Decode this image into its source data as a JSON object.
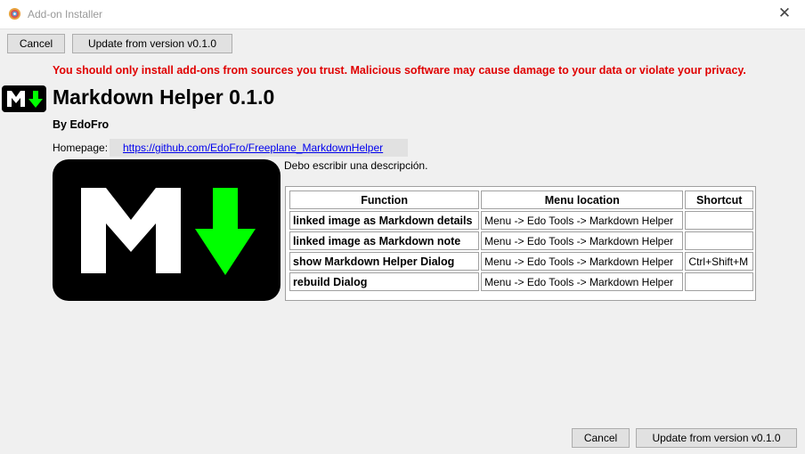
{
  "window": {
    "title": "Add-on Installer",
    "close_glyph": "✕"
  },
  "buttons": {
    "cancel": "Cancel",
    "update": "Update from version v0.1.0"
  },
  "warning": "You should only install add-ons from sources you trust. Malicious software may cause damage to your data or violate your privacy.",
  "addon": {
    "title": "Markdown Helper 0.1.0",
    "author": "By EdoFro",
    "homepage_label": "Homepage:",
    "homepage_url": "https://github.com/EdoFro/Freeplane_MarkdownHelper",
    "description": "Debo escribir una descripción.",
    "logo_colors": {
      "background": "#000000",
      "letter": "#ffffff",
      "arrow": "#00ff00"
    }
  },
  "table": {
    "headers": [
      "Function",
      "Menu location",
      "Shortcut"
    ],
    "rows": [
      {
        "function": "linked image as Markdown details",
        "menu": "Menu -> Edo Tools -> Markdown Helper",
        "shortcut": ""
      },
      {
        "function": "linked image as Markdown note",
        "menu": "Menu -> Edo Tools -> Markdown Helper",
        "shortcut": ""
      },
      {
        "function": "show Markdown Helper Dialog",
        "menu": "Menu -> Edo Tools -> Markdown Helper",
        "shortcut": "Ctrl+Shift+M"
      },
      {
        "function": "rebuild Dialog",
        "menu": "Menu -> Edo Tools -> Markdown Helper",
        "shortcut": ""
      }
    ]
  }
}
